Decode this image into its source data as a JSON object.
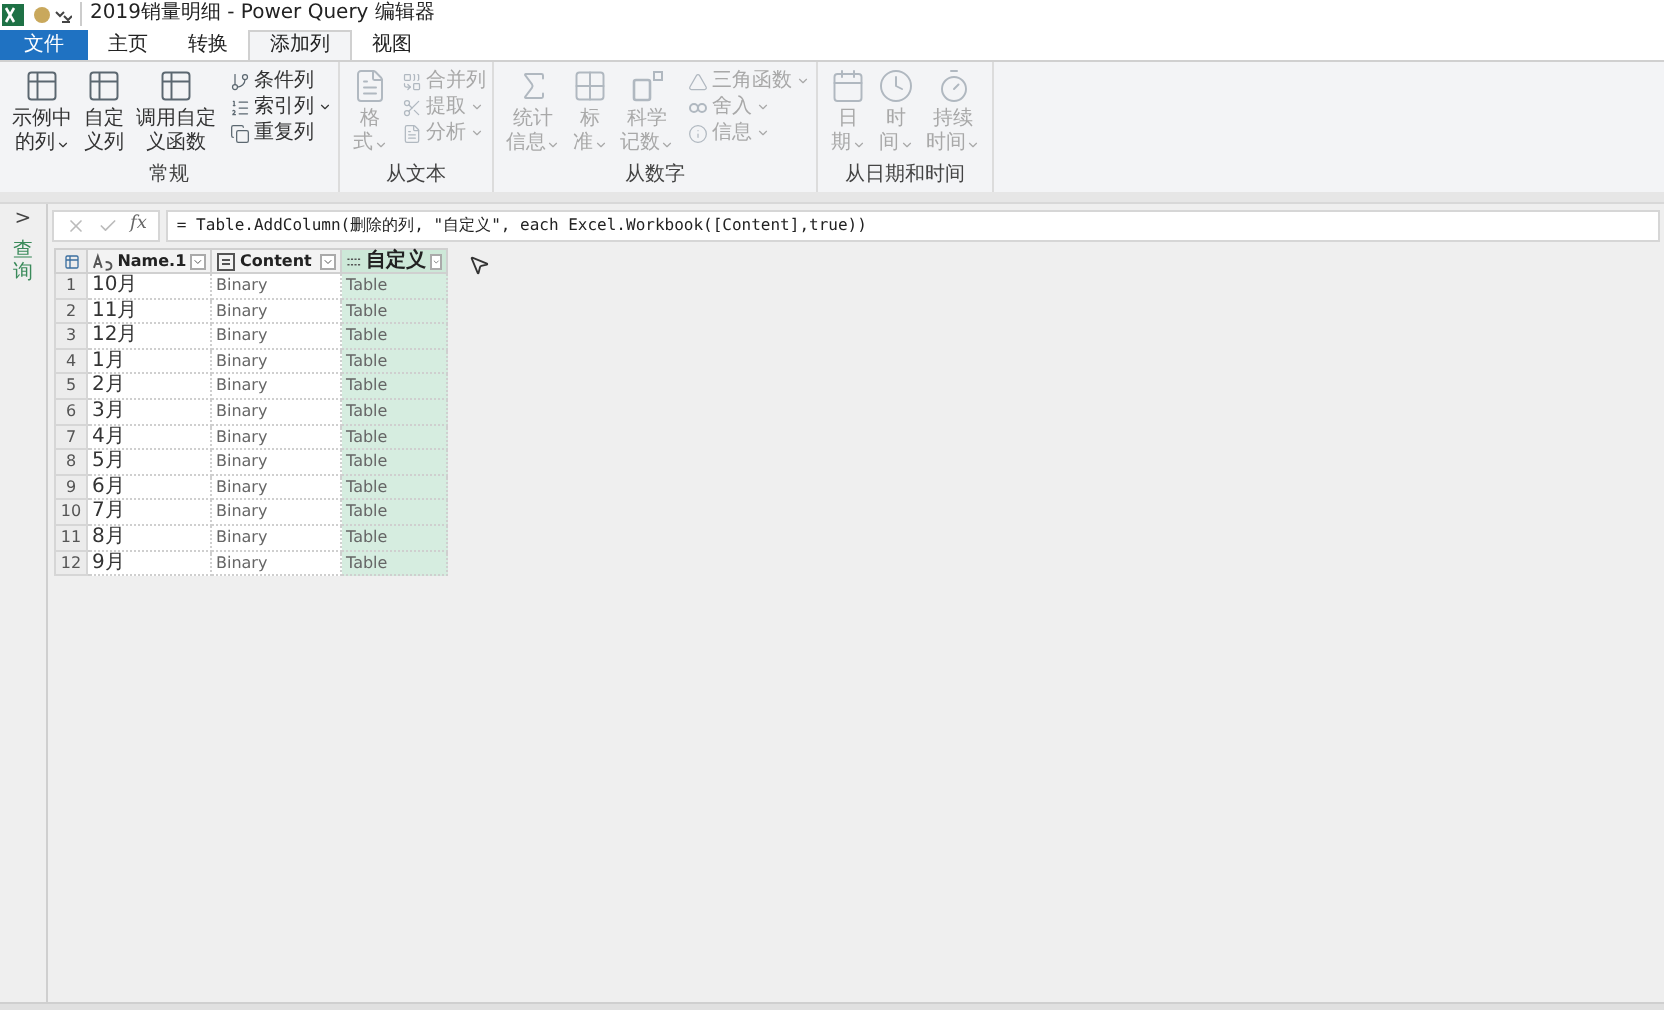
{
  "window": {
    "title": "2019销量明细 - Power Query 编辑器"
  },
  "tabs": [
    {
      "label": "文件",
      "kind": "file",
      "selected": false
    },
    {
      "label": "主页",
      "kind": "tab",
      "selected": false
    },
    {
      "label": "转换",
      "kind": "tab",
      "selected": false
    },
    {
      "label": "添加列",
      "kind": "tab",
      "selected": true
    },
    {
      "label": "视图",
      "kind": "tab",
      "selected": false
    }
  ],
  "ribbon_groups": [
    {
      "label": "常规",
      "items": [
        {
          "kind": "large",
          "lines": [
            "示例中",
            "的列"
          ],
          "dropdown": true,
          "disabled": false
        },
        {
          "kind": "large",
          "lines": [
            "自定",
            "义列"
          ],
          "dropdown": false,
          "disabled": false
        },
        {
          "kind": "large",
          "lines": [
            "调用自定",
            "义函数"
          ],
          "dropdown": false,
          "disabled": false
        },
        {
          "kind": "small",
          "lines": [
            "条件列"
          ],
          "dropdown": false,
          "disabled": false
        },
        {
          "kind": "small",
          "lines": [
            "索引列"
          ],
          "dropdown": true,
          "disabled": false
        },
        {
          "kind": "small",
          "lines": [
            "重复列"
          ],
          "dropdown": false,
          "disabled": false
        }
      ]
    },
    {
      "label": "从文本",
      "items": [
        {
          "kind": "large",
          "lines": [
            "格",
            "式"
          ],
          "dropdown": true,
          "disabled": true
        },
        {
          "kind": "small",
          "lines": [
            "合并列"
          ],
          "dropdown": false,
          "disabled": true
        },
        {
          "kind": "small",
          "lines": [
            "提取"
          ],
          "dropdown": true,
          "disabled": true
        },
        {
          "kind": "small",
          "lines": [
            "分析"
          ],
          "dropdown": true,
          "disabled": true
        }
      ]
    },
    {
      "label": "从数字",
      "items": [
        {
          "kind": "large",
          "lines": [
            "统计",
            "信息"
          ],
          "dropdown": true,
          "disabled": true
        },
        {
          "kind": "large",
          "lines": [
            "标",
            "准"
          ],
          "dropdown": true,
          "disabled": true
        },
        {
          "kind": "large",
          "lines": [
            "科学",
            "记数"
          ],
          "dropdown": true,
          "disabled": true
        },
        {
          "kind": "small",
          "lines": [
            "三角函数"
          ],
          "dropdown": true,
          "disabled": true
        },
        {
          "kind": "small",
          "lines": [
            "舍入"
          ],
          "dropdown": true,
          "disabled": true
        },
        {
          "kind": "small",
          "lines": [
            "信息"
          ],
          "dropdown": true,
          "disabled": true
        }
      ]
    },
    {
      "label": "从日期和时间",
      "items": [
        {
          "kind": "large",
          "lines": [
            "日",
            "期"
          ],
          "dropdown": true,
          "disabled": true
        },
        {
          "kind": "large",
          "lines": [
            "时",
            "间"
          ],
          "dropdown": true,
          "disabled": true
        },
        {
          "kind": "large",
          "lines": [
            "持续",
            "时间"
          ],
          "dropdown": true,
          "disabled": true
        }
      ]
    }
  ],
  "sidebar": {
    "toggle": ">",
    "label": "查询"
  },
  "formula_bar": {
    "fx": "fx",
    "formula": "= Table.AddColumn(删除的列, \"自定义\", each Excel.Workbook([Content],true))"
  },
  "table": {
    "columns": [
      {
        "name": "Name.1",
        "kind": "text",
        "selected": false
      },
      {
        "name": "Content",
        "kind": "binary",
        "selected": false
      },
      {
        "name": "自定义",
        "kind": "any",
        "selected": true
      }
    ],
    "rows": [
      {
        "n": "1",
        "cells": [
          "10月",
          "Binary",
          "Table"
        ]
      },
      {
        "n": "2",
        "cells": [
          "11月",
          "Binary",
          "Table"
        ]
      },
      {
        "n": "3",
        "cells": [
          "12月",
          "Binary",
          "Table"
        ]
      },
      {
        "n": "4",
        "cells": [
          "1月",
          "Binary",
          "Table"
        ]
      },
      {
        "n": "5",
        "cells": [
          "2月",
          "Binary",
          "Table"
        ]
      },
      {
        "n": "6",
        "cells": [
          "3月",
          "Binary",
          "Table"
        ]
      },
      {
        "n": "7",
        "cells": [
          "4月",
          "Binary",
          "Table"
        ]
      },
      {
        "n": "8",
        "cells": [
          "5月",
          "Binary",
          "Table"
        ]
      },
      {
        "n": "9",
        "cells": [
          "6月",
          "Binary",
          "Table"
        ]
      },
      {
        "n": "10",
        "cells": [
          "7月",
          "Binary",
          "Table"
        ]
      },
      {
        "n": "11",
        "cells": [
          "8月",
          "Binary",
          "Table"
        ]
      },
      {
        "n": "12",
        "cells": [
          "9月",
          "Binary",
          "Table"
        ]
      }
    ]
  }
}
